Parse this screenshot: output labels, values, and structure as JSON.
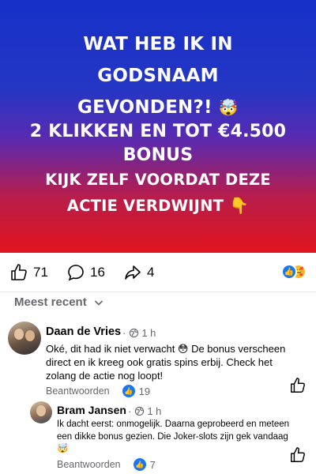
{
  "banner": {
    "headline": "WAT HEB IK IN GODSNAAM GEVONDEN?!",
    "headline_emoji": "🤯",
    "bonus_line": "2 KLIKKEN EN TOT €4.500 BONUS",
    "cta": "KIJK ZELF VOORDAT DEZE ACTIE VERDWIJNT",
    "cta_emoji": "👇",
    "colors": {
      "top": "#1630c8",
      "bottom": "#e2141e"
    }
  },
  "reactions": {
    "likes": "71",
    "comments": "16",
    "shares": "4",
    "like_icon": "thumbs-up-icon",
    "comment_icon": "comment-bubble-icon",
    "share_icon": "share-arrow-icon",
    "summary_icons": [
      "like-reaction-icon",
      "care-reaction-icon"
    ]
  },
  "sort": {
    "label": "Meest recent"
  },
  "comments": [
    {
      "name": "Daan de Vries",
      "time": "1 h",
      "text": "Oké, dit had ik niet verwacht 😳 De bonus verscheen direct en ik kreeg ook gratis spins erbij. Check het zolang de actie nog loopt!",
      "reply_label": "Beantwoorden",
      "likes": "19"
    },
    {
      "name": "Bram Jansen",
      "time": "1 h",
      "text": "Ik dacht eerst: onmogelijk. Daarna geprobeerd en meteen een dikke bonus gezien. Die Joker-slots zijn gek vandaag 🤯",
      "reply_label": "Beantwoorden",
      "likes": "7"
    }
  ],
  "accent": "#1877f2"
}
